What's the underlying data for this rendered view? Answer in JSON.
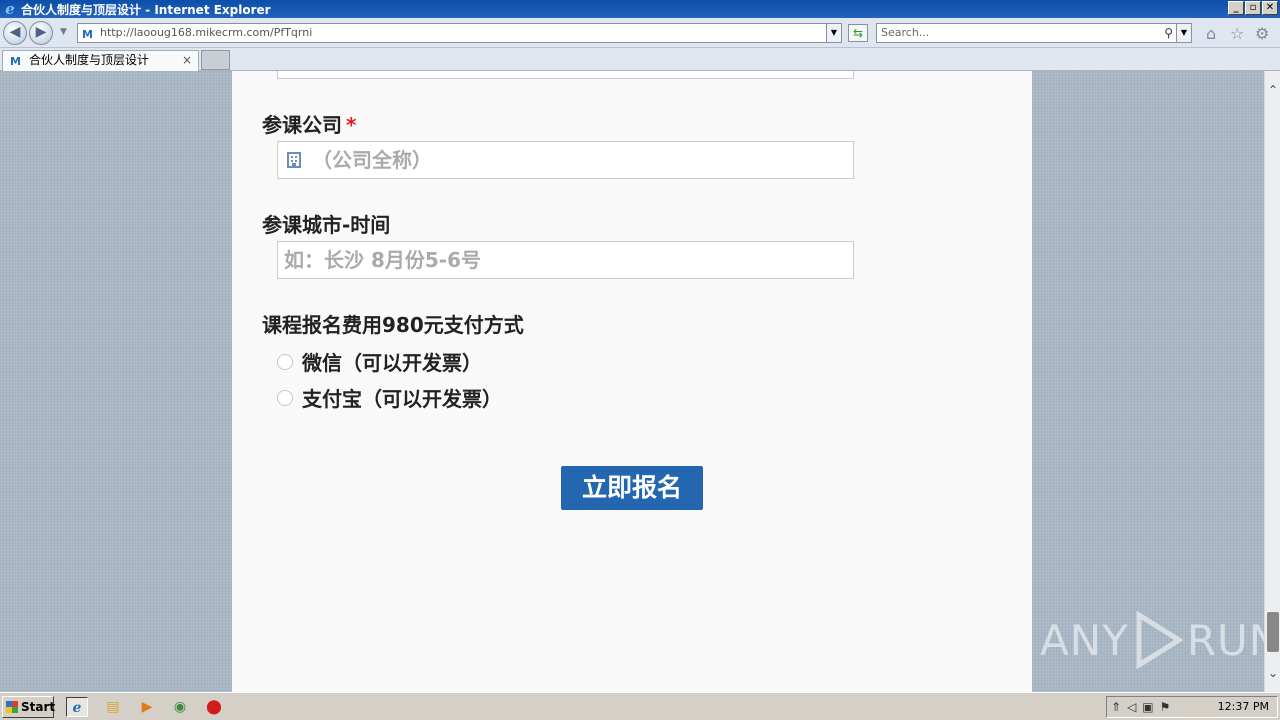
{
  "window": {
    "title": "合伙人制度与顶层设计 - Internet Explorer",
    "minimize": "_",
    "restore": "▫",
    "close": "✕"
  },
  "nav": {
    "address": "http://laooug168.mikecrm.com/PfTqrni",
    "search_placeholder": "Search...",
    "icons": [
      "back-icon",
      "forward-icon",
      "refresh-icon",
      "home-icon",
      "favorites-star-icon",
      "settings-gear-icon"
    ]
  },
  "tabs": [
    {
      "label": "合伙人制度与顶层设计",
      "close": "×"
    }
  ],
  "form": {
    "company": {
      "label": "参课公司",
      "required_mark": "*",
      "placeholder": "（公司全称）"
    },
    "city_time": {
      "label": "参课城市-时间",
      "placeholder": "如：长沙 8月份5-6号"
    },
    "payment": {
      "label": "课程报名费用980元支付方式",
      "options": [
        "微信（可以开发票）",
        "支付宝（可以开发票）"
      ]
    },
    "submit_label": "立即报名"
  },
  "watermark": {
    "left": "ANY",
    "right": "RUN"
  },
  "taskbar": {
    "start_label": "Start",
    "clock": "12:37 PM"
  }
}
